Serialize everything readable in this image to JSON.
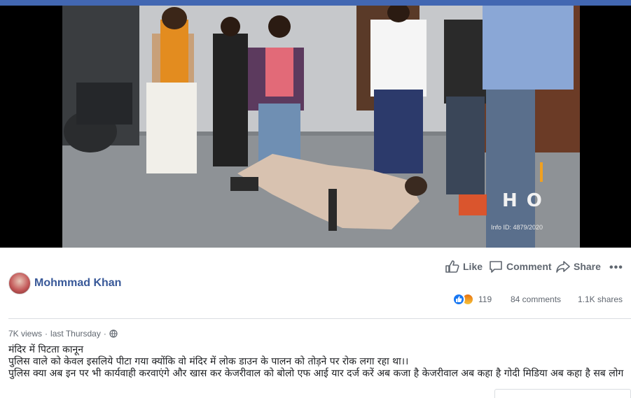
{
  "video": {
    "watermark": "H  O",
    "watermark_sub": "Info ID: 4879/2020"
  },
  "actions": {
    "like_label": "Like",
    "comment_label": "Comment",
    "share_label": "Share",
    "more_label": "•••"
  },
  "author": {
    "name": "Mohmmad Khan"
  },
  "stats": {
    "reaction_count": "119",
    "comments": "84 comments",
    "shares": "1.1K shares"
  },
  "meta": {
    "views": "7K views",
    "separator": "·",
    "time": "last Thursday",
    "separator2": "·",
    "privacy_icon": "globe-icon"
  },
  "post": {
    "line1": "मंदिर में पिटता कानून",
    "line2": "पुलिस वाले को केवल इसलिये पीटा गया क्योंकि वो मंदिर में लोक डाउन के पालन को तोड़ने पर रोक लगा रहा था।।",
    "line3": "पुलिस क्या अब इन पर भी कार्यवाही करवाएंगे और खास कर केजरीवाल को बोलो एफ आई यार दर्ज करें अब कजा है केजरीवाल अब कहा है गोदी मिडिया अब कहा है सब लोग"
  },
  "colors": {
    "brand": "#4267b2",
    "link": "#385898",
    "muted": "#606770",
    "like_blue": "#1877f2"
  }
}
